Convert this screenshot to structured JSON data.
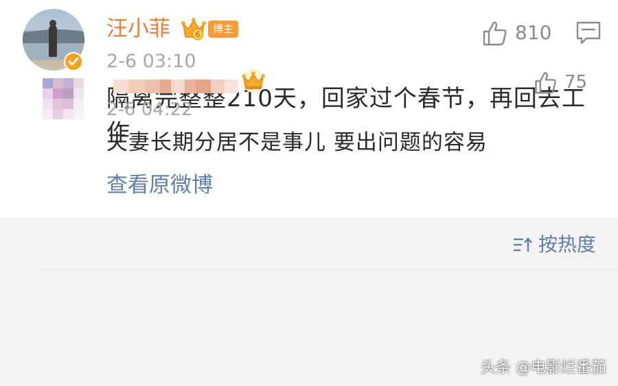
{
  "post": {
    "username": "汪小菲",
    "badge_label": "博主",
    "level_number": "6",
    "like_count": "810",
    "time": "2-6 03:10",
    "text": "隔离完整整210天，回家过个春节，再回去工作",
    "view_original_label": "查看原微博",
    "icons": {
      "verified": "verified-check-icon",
      "crown": "crown-icon",
      "like": "thumbs-up-icon",
      "comment": "comment-icon"
    }
  },
  "comments": {
    "sort_label": "按热度",
    "sort_icon": "sort-icon",
    "items": [
      {
        "time": "2-6 04:22",
        "like_count": "75",
        "text": "夫妻长期分居不是事儿 要出问题的容易"
      }
    ]
  },
  "watermark": "头条 @电影烂番茄",
  "colors": {
    "username": "#f27b35",
    "badge": "#ff9a35",
    "link": "#5f7ea8",
    "muted": "#a7a7a7",
    "comment_bg": "#f3f3f3"
  }
}
